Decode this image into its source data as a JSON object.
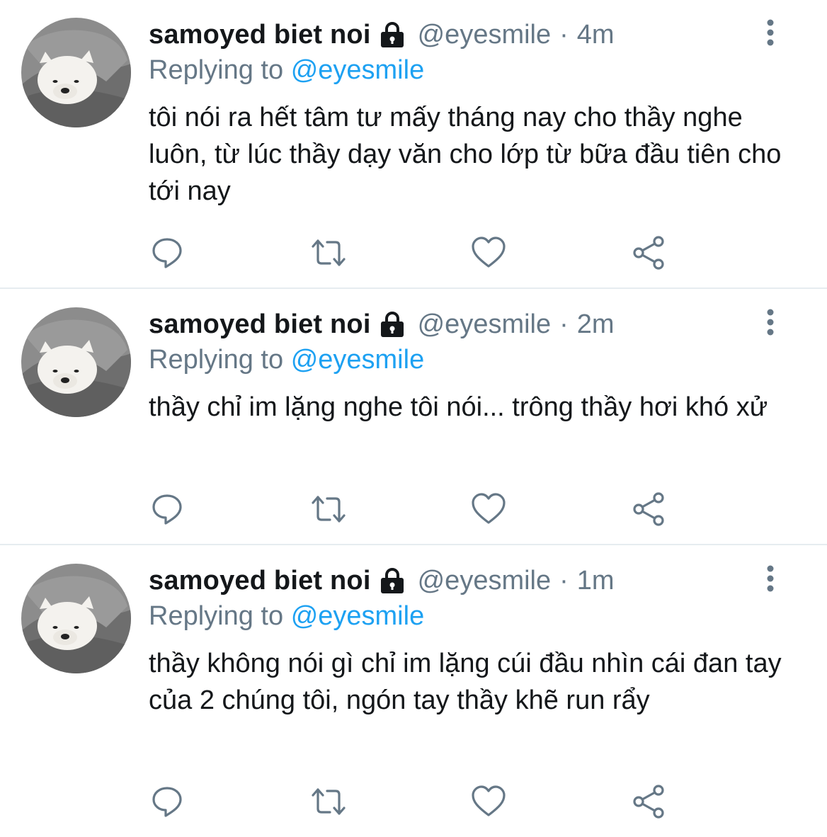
{
  "colors": {
    "text_primary": "#14171a",
    "text_secondary": "#657786",
    "link": "#1da1f2",
    "separator": "#e6ecf0"
  },
  "icons": {
    "lock": "lock-icon",
    "more": "more-vertical-icon",
    "reply": "reply-bubble-icon",
    "retweet": "retweet-icon",
    "like": "heart-icon",
    "share": "share-icon"
  },
  "tweets": [
    {
      "name": "samoyed biet noi",
      "handle": "@eyesmile",
      "separator": "·",
      "time": "4m",
      "replying_label": "Replying to",
      "replying_to": "@eyesmile",
      "text": "tôi nói ra hết tâm tư mấy tháng nay cho thầy nghe luôn, từ lúc thầy dạy văn cho lớp từ bữa đầu tiên cho tới nay"
    },
    {
      "name": "samoyed biet noi",
      "handle": "@eyesmile",
      "separator": "·",
      "time": "2m",
      "replying_label": "Replying to",
      "replying_to": "@eyesmile",
      "text": "thầy chỉ im lặng nghe tôi nói... trông thầy hơi khó xử"
    },
    {
      "name": "samoyed biet noi",
      "handle": "@eyesmile",
      "separator": "·",
      "time": "1m",
      "replying_label": "Replying to",
      "replying_to": "@eyesmile",
      "text": "thầy không nói gì chỉ im lặng cúi đầu nhìn cái đan tay của 2 chúng tôi, ngón tay thầy khẽ run rẩy"
    }
  ]
}
